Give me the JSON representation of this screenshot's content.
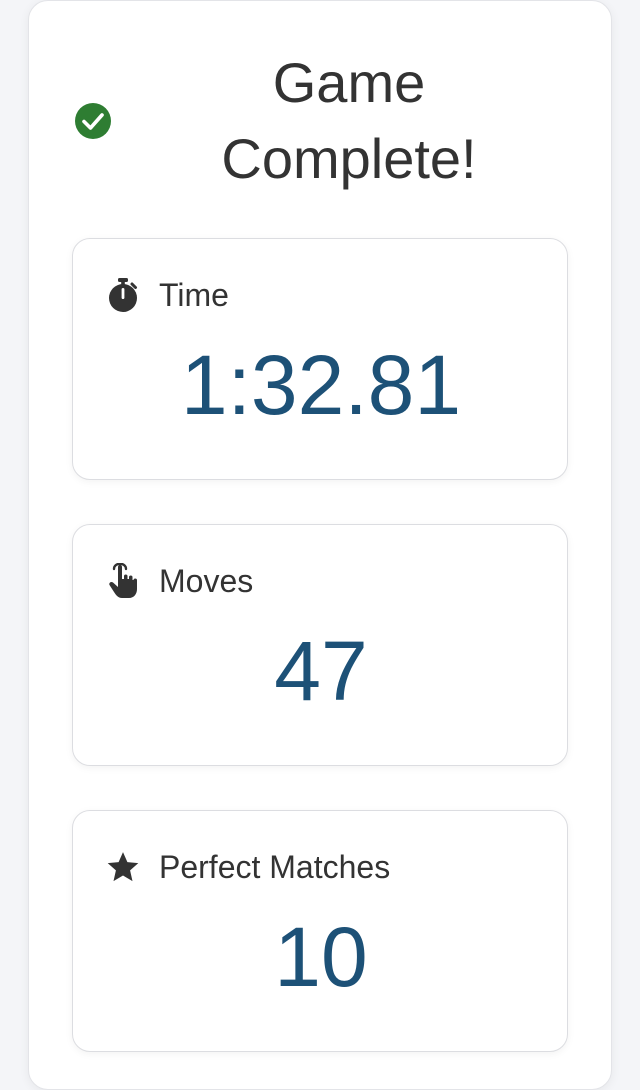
{
  "dialog": {
    "title_line1": "Game",
    "title_line2": "Complete!",
    "status_icon": "check-circle-icon"
  },
  "stats": {
    "time": {
      "label": "Time",
      "value": "1:32.81",
      "icon": "stopwatch-icon"
    },
    "moves": {
      "label": "Moves",
      "value": "47",
      "icon": "tap-hand-icon"
    },
    "perfect_matches": {
      "label": "Perfect Matches",
      "value": "10",
      "icon": "star-icon"
    }
  },
  "colors": {
    "accent_value": "#1d5177",
    "success": "#2e7d32",
    "text": "#333333"
  }
}
